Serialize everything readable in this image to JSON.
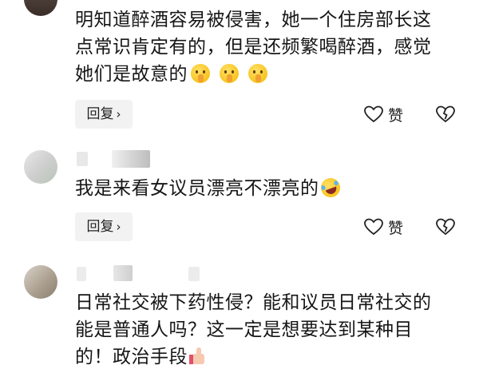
{
  "comments": [
    {
      "lines": [
        "明知道醉酒容易被侵害，她一个住房部长这",
        "点常识肯定有的，但是还频繁喝醉酒，感觉",
        "她们是故意的"
      ],
      "emojis": [
        "shushing-face-emoji",
        "shushing-face-emoji",
        "shushing-face-emoji"
      ],
      "reply_label": "回复",
      "like_label": "赞"
    },
    {
      "lines": [
        "我是来看女议员漂亮不漂亮的"
      ],
      "emojis": [
        "rolling-laughing-emoji"
      ],
      "reply_label": "回复",
      "like_label": "赞"
    },
    {
      "lines": [
        "日常社交被下药性侵？能和议员日常社交的",
        "能是普通人吗？这一定是想要达到某种目",
        "的！政治手段"
      ],
      "emojis": [
        "thumbs-up-emoji"
      ]
    }
  ],
  "icons": {
    "reply_chevron": "chevron-right-icon",
    "like": "heart-outline-icon",
    "dislike": "broken-heart-icon"
  }
}
